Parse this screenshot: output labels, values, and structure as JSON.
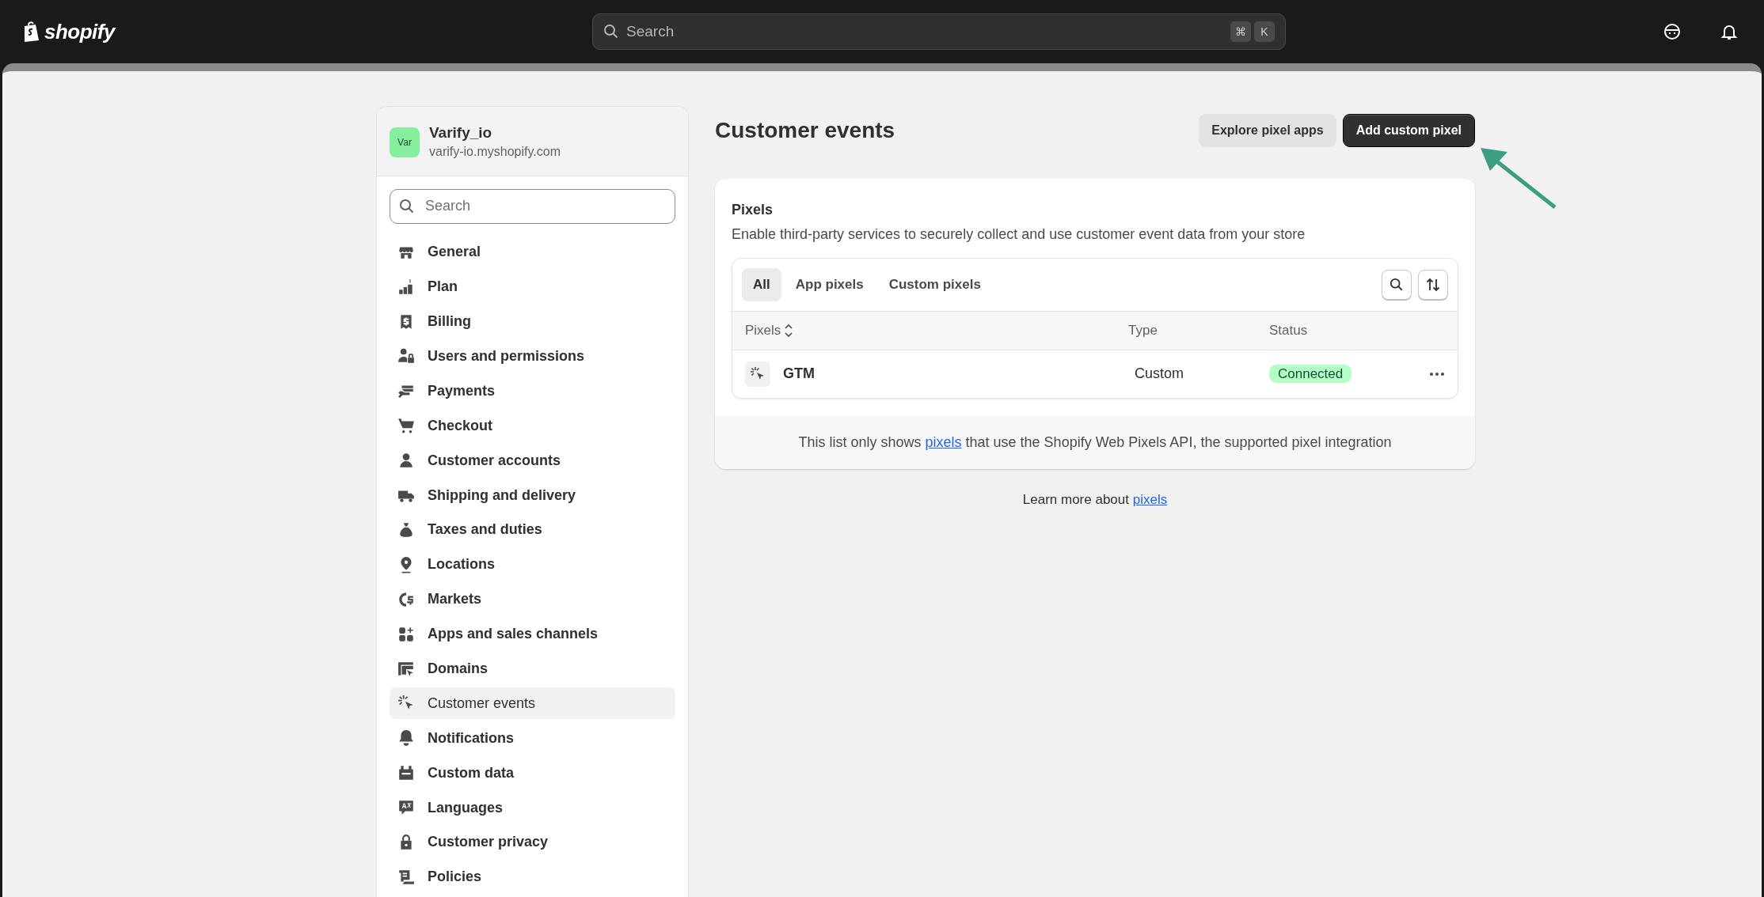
{
  "topbar": {
    "logo": "shopify",
    "search": {
      "placeholder": "Search",
      "shortcut_keys": [
        "⌘",
        "K"
      ]
    }
  },
  "sidebar": {
    "store": {
      "avatar": "Var",
      "name": "Varify_io",
      "domain": "varify-io.myshopify.com"
    },
    "search": {
      "placeholder": "Search"
    },
    "items": [
      {
        "label": "General",
        "selected": false
      },
      {
        "label": "Plan",
        "selected": false
      },
      {
        "label": "Billing",
        "selected": false
      },
      {
        "label": "Users and permissions",
        "selected": false
      },
      {
        "label": "Payments",
        "selected": false
      },
      {
        "label": "Checkout",
        "selected": false
      },
      {
        "label": "Customer accounts",
        "selected": false
      },
      {
        "label": "Shipping and delivery",
        "selected": false
      },
      {
        "label": "Taxes and duties",
        "selected": false
      },
      {
        "label": "Locations",
        "selected": false
      },
      {
        "label": "Markets",
        "selected": false
      },
      {
        "label": "Apps and sales channels",
        "selected": false
      },
      {
        "label": "Domains",
        "selected": false
      },
      {
        "label": "Customer events",
        "selected": true
      },
      {
        "label": "Notifications",
        "selected": false
      },
      {
        "label": "Custom data",
        "selected": false
      },
      {
        "label": "Languages",
        "selected": false
      },
      {
        "label": "Customer privacy",
        "selected": false
      },
      {
        "label": "Policies",
        "selected": false
      }
    ]
  },
  "page": {
    "title": "Customer events",
    "buttons": [
      {
        "label": "Explore pixel apps",
        "kind": "secondary"
      },
      {
        "label": "Add custom pixel",
        "kind": "primary"
      }
    ]
  },
  "pixels_card": {
    "title": "Pixels",
    "description": "Enable third-party services to securely collect and use customer event data from your store",
    "tabs": [
      {
        "label": "All",
        "selected": true
      },
      {
        "label": "App pixels",
        "selected": false
      },
      {
        "label": "Custom pixels",
        "selected": false
      }
    ],
    "table": {
      "columns": [
        "Pixels",
        "Type",
        "Status"
      ],
      "rows": [
        {
          "name": "GTM",
          "type": "Custom",
          "status": "Connected",
          "connected": true
        }
      ]
    },
    "footer_note": {
      "before": "This list only shows ",
      "link": "pixels",
      "after": " that use the Shopify Web Pixels API, the supported pixel integration"
    }
  },
  "learn_more": {
    "text": "Learn more about ",
    "link": "pixels"
  }
}
